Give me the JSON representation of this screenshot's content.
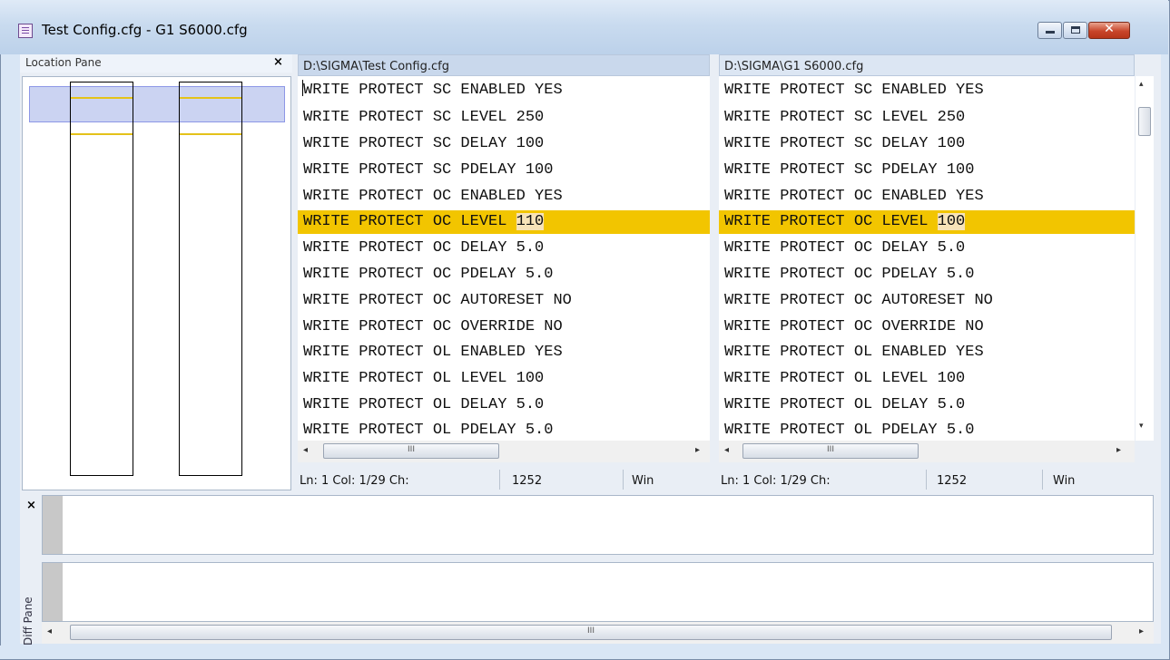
{
  "window": {
    "title": "Test Config.cfg - G1 S6000.cfg",
    "controls": {
      "minimize": "minimize",
      "maximize": "maximize",
      "close": "✕"
    }
  },
  "location_pane": {
    "title": "Location Pane",
    "close": "×"
  },
  "left_editor": {
    "path": "D:\\SIGMA\\Test Config.cfg",
    "lines": [
      "WRITE PROTECT SC ENABLED YES",
      "WRITE PROTECT SC LEVEL 250",
      "WRITE PROTECT SC DELAY 100",
      "WRITE PROTECT SC PDELAY 100",
      "WRITE PROTECT OC ENABLED YES",
      "WRITE PROTECT OC LEVEL ",
      "WRITE PROTECT OC DELAY 5.0",
      "WRITE PROTECT OC PDELAY 5.0",
      "WRITE PROTECT OC AUTORESET NO",
      "WRITE PROTECT OC OVERRIDE NO",
      "WRITE PROTECT OL ENABLED YES",
      "WRITE PROTECT OL LEVEL 100",
      "WRITE PROTECT OL DELAY 5.0",
      "WRITE PROTECT OL PDELAY 5.0"
    ],
    "diff_value": "110",
    "status": {
      "position": "Ln: 1  Col: 1/29  Ch:",
      "encoding": "1252",
      "line_ending": "Win"
    }
  },
  "right_editor": {
    "path": "D:\\SIGMA\\G1 S6000.cfg",
    "lines": [
      "WRITE PROTECT SC ENABLED YES",
      "WRITE PROTECT SC LEVEL 250",
      "WRITE PROTECT SC DELAY 100",
      "WRITE PROTECT SC PDELAY 100",
      "WRITE PROTECT OC ENABLED YES",
      "WRITE PROTECT OC LEVEL ",
      "WRITE PROTECT OC DELAY 5.0",
      "WRITE PROTECT OC PDELAY 5.0",
      "WRITE PROTECT OC AUTORESET NO",
      "WRITE PROTECT OC OVERRIDE NO",
      "WRITE PROTECT OL ENABLED YES",
      "WRITE PROTECT OL LEVEL 100",
      "WRITE PROTECT OL DELAY 5.0",
      "WRITE PROTECT OL PDELAY 5.0"
    ],
    "diff_value": "100",
    "status": {
      "position": "Ln: 1  Col: 1/29  Ch:",
      "encoding": "1252",
      "line_ending": "Win"
    }
  },
  "scroll": {
    "thumb_grip": "III",
    "left_arrow": "◂",
    "right_arrow": "▸",
    "up_arrow": "▴",
    "down_arrow": "▾"
  },
  "diff_pane": {
    "title": "Diff Pane",
    "close": "×"
  },
  "colors": {
    "highlight": "#f2c500",
    "diff_text_bg": "#f7e3b8",
    "location_marker": "#e4c21a"
  }
}
